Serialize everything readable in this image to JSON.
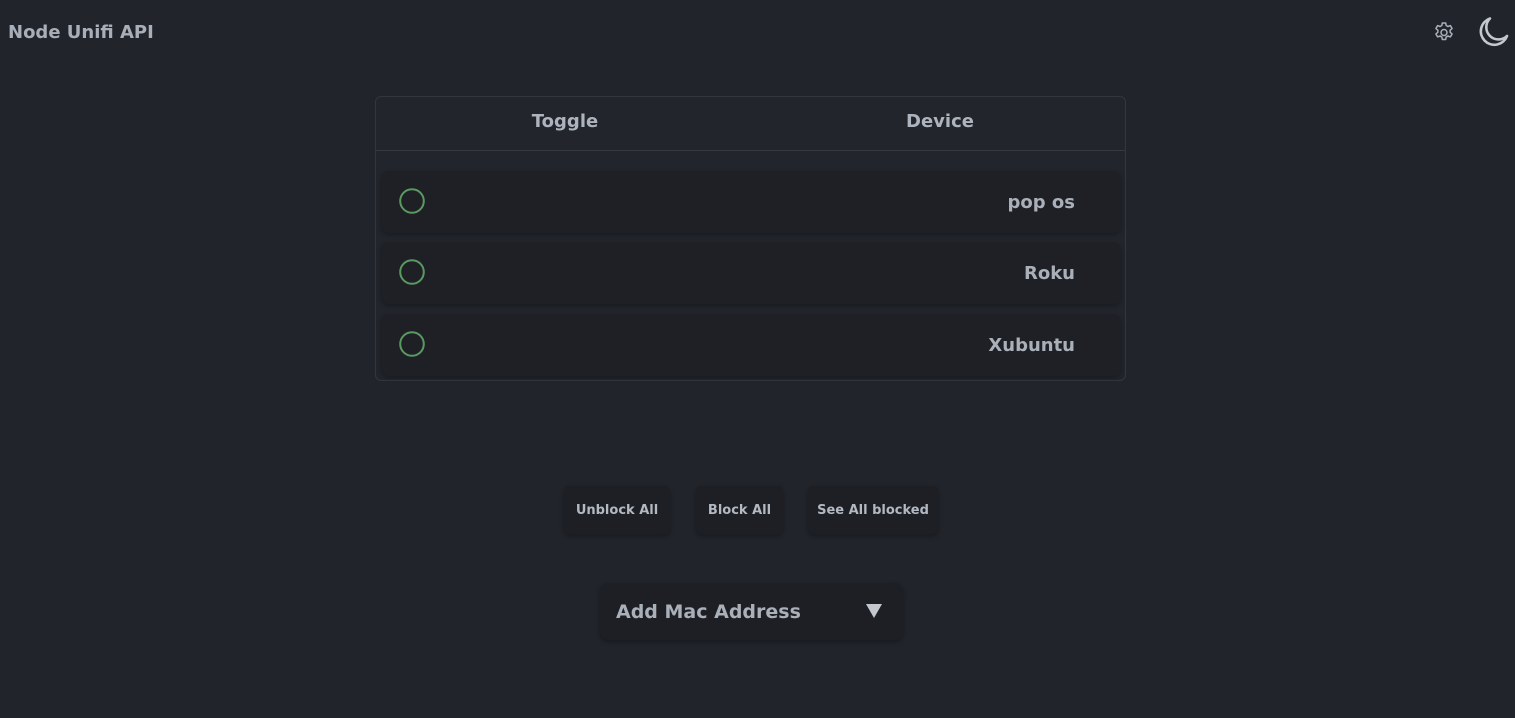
{
  "app": {
    "title": "Node Unifi API"
  },
  "header": {
    "settings_icon": "gear-icon",
    "theme_icon": "moon-icon"
  },
  "table": {
    "columns": [
      "Toggle",
      "Device"
    ],
    "rows": [
      {
        "name": "pop os",
        "toggle_state": "off"
      },
      {
        "name": "Roku",
        "toggle_state": "off"
      },
      {
        "name": "Xubuntu",
        "toggle_state": "off"
      }
    ]
  },
  "actions": {
    "unblock_all": "Unblock All",
    "block_all": "Block All",
    "see_all_blocked": "See All blocked"
  },
  "mac_form": {
    "label": "Add Mac Address",
    "caret_icon": "caret-down-icon"
  },
  "colors": {
    "background": "#21242b",
    "toggle_ring": "#5a9960",
    "text": "#aab0b9"
  }
}
